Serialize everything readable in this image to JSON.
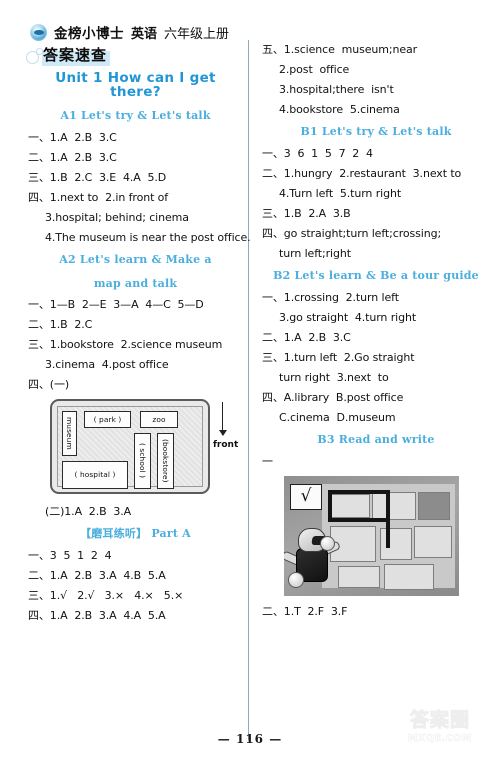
{
  "header": {
    "brand": "金榜小博士",
    "subject": "英语",
    "grade": "六年级上册",
    "quick_answer": "答案速查",
    "logo_icon": "eye-logo-icon"
  },
  "unit": {
    "title": "Unit 1   How can I get there?"
  },
  "left_column": {
    "a1_heading": "A1   Let's try & Let's talk",
    "a1_answers": [
      "一、1.A  2.B  3.C",
      "二、1.A  2.B  3.C",
      "三、1.B  2.C  3.E  4.A  5.D",
      "四、1.next to  2.in front of",
      "3.hospital; behind; cinema",
      "4.The museum is near the post office."
    ],
    "a2_heading_line1": "A2   Let's learn & Make a",
    "a2_heading_line2": "map and talk",
    "a2_answers": [
      "一、1—B  2—E  3—A  4—C  5—D",
      "二、1.B  2.C",
      "三、1.bookstore  2.science museum",
      "3.cinema  4.post office",
      "四、(一)"
    ],
    "map_figure": {
      "name": "map-diagram",
      "boxes": [
        {
          "id": "museum",
          "label": "museum",
          "orientation": "vertical"
        },
        {
          "id": "park",
          "label": "( park )",
          "orientation": "horizontal"
        },
        {
          "id": "zoo",
          "label": "zoo",
          "orientation": "horizontal"
        },
        {
          "id": "school",
          "label": "( school )",
          "orientation": "vertical"
        },
        {
          "id": "bookstore",
          "label": "(bookstore)",
          "orientation": "vertical"
        },
        {
          "id": "hospital",
          "label": "( hospital )",
          "orientation": "horizontal"
        }
      ],
      "direction_label": "front"
    },
    "after_map": "(二)1.A  2.B  3.A",
    "listening_heading": "【磨耳练听】  Part A",
    "listening_answers": [
      "一、3  5  1  2  4",
      "二、1.A  2.B  3.A  4.B  5.A",
      "三、1.√   2.√   3.×   4.×   5.×",
      "四、1.A  2.B  3.A  4.A  5.A"
    ]
  },
  "right_column": {
    "section5_answers": [
      "五、1.science  museum;near",
      "2.post  office",
      "3.hospital;there  isn't",
      "4.bookstore  5.cinema"
    ],
    "b1_heading": "B1   Let's try & Let's talk",
    "b1_answers": [
      "一、3  6  1  5  7  2  4",
      "二、1.hungry  2.restaurant  3.next to",
      "4.Turn left  5.turn right",
      "三、1.B  2.A  3.B",
      "四、go straight;turn left;crossing;",
      "turn left;right"
    ],
    "b2_heading": "B2   Let's learn & Be a tour guide",
    "b2_answers": [
      "一、1.crossing  2.turn left",
      "3.go straight  4.turn right",
      "二、1.A  2.B  3.C",
      "三、1.turn left  2.Go straight",
      "turn right  3.next  to",
      "四、A.library  B.post office",
      "C.cinema  D.museum"
    ],
    "b3_heading": "B3   Read and write",
    "b3_marker": "一",
    "photo_figure": {
      "name": "read-and-write-photo",
      "checkmark": "√"
    },
    "b3_answer": "二、1.T  2.F  3.F"
  },
  "footer": {
    "page_number": "— 116 —",
    "watermark_logo": "答案圈",
    "watermark_url": "MXQE.COM"
  }
}
